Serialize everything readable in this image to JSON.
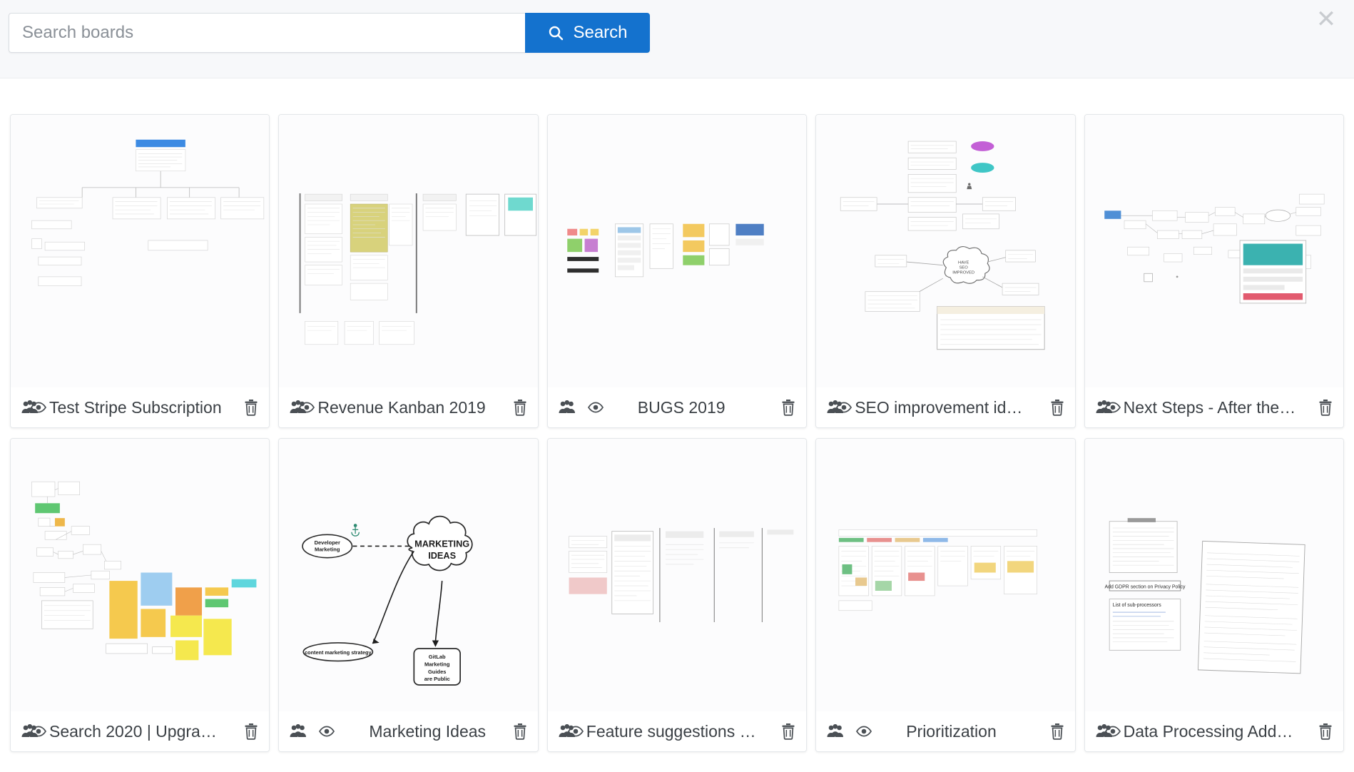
{
  "search": {
    "placeholder": "Search boards",
    "value": "",
    "button_label": "Search",
    "button_icon": "search-icon",
    "button_color": "#1472ce"
  },
  "close": {
    "icon": "close-icon",
    "label": "✕"
  },
  "icons": {
    "group": "users-group-icon",
    "eye": "eye-icon",
    "trash": "trash-icon",
    "anchor": "anchor-icon"
  },
  "boards": [
    {
      "title": "Test Stripe Subscription",
      "shared": true,
      "watched": true,
      "icons_overlap": true,
      "thumb": "test-stripe-subscription"
    },
    {
      "title": "Revenue Kanban 2019",
      "shared": true,
      "watched": true,
      "icons_overlap": true,
      "thumb": "revenue-kanban-2019"
    },
    {
      "title": "BUGS 2019",
      "shared": true,
      "watched": true,
      "icons_overlap": false,
      "thumb": "bugs-2019"
    },
    {
      "title": "SEO improvement id…",
      "shared": true,
      "watched": true,
      "icons_overlap": true,
      "thumb": "seo-improvement-ideas"
    },
    {
      "title": "Next Steps - After the…",
      "shared": true,
      "watched": true,
      "icons_overlap": true,
      "thumb": "next-steps-after-the"
    },
    {
      "title": "Search 2020 | Upgra…",
      "shared": true,
      "watched": true,
      "icons_overlap": true,
      "thumb": "search-2020-upgrade"
    },
    {
      "title": "Marketing Ideas",
      "shared": true,
      "watched": true,
      "icons_overlap": false,
      "thumb": "marketing-ideas"
    },
    {
      "title": "Feature suggestions …",
      "shared": true,
      "watched": true,
      "icons_overlap": true,
      "thumb": "feature-suggestions"
    },
    {
      "title": "Prioritization",
      "shared": true,
      "watched": true,
      "icons_overlap": false,
      "thumb": "prioritization"
    },
    {
      "title": "Data Processing Add…",
      "shared": true,
      "watched": true,
      "icons_overlap": true,
      "thumb": "data-processing-addendum"
    }
  ],
  "marketing_ideas_thumb": {
    "node_developer_marketing": "Developer\nMarketing",
    "cloud_line1": "MARKETING",
    "cloud_line2": "IDEAS",
    "node_content_strategy": "content marketing strategy",
    "box_line1": "GitLab",
    "box_line2": "Marketing",
    "box_line3": "Guides",
    "box_line4": "are Public"
  }
}
